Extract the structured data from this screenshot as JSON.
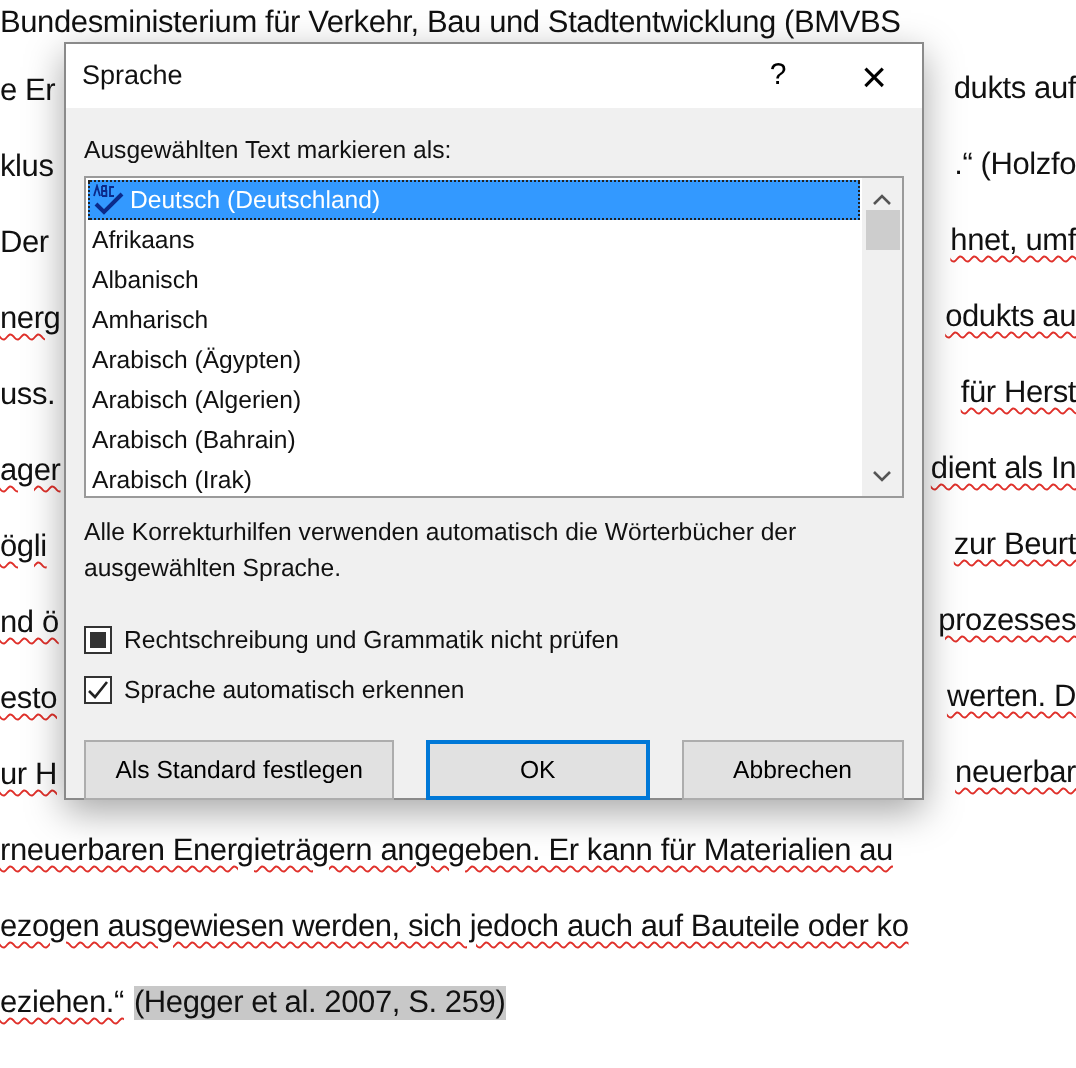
{
  "document": {
    "lines": [
      {
        "left": "Bundesministerium für Verkehr, Bau und Stadtentwicklung (BMVBS",
        "left_flagged": false
      },
      {
        "left": "e Er",
        "right": "dukts auf",
        "left_flagged": false,
        "right_flagged": false
      },
      {
        "left": "klus",
        "right": ".“ (Holzfo",
        "left_flagged": false,
        "right_flagged": false
      },
      {
        "left": "Der",
        "right": "hnet, umf",
        "left_flagged": false,
        "right_flagged": true
      },
      {
        "left": "nerg",
        "right": "odukts au",
        "left_flagged": true,
        "right_flagged": true
      },
      {
        "left": "uss.",
        "right": "für Herst",
        "left_flagged": false,
        "right_flagged": true
      },
      {
        "left": "ager",
        "right": "dient als In",
        "left_flagged": true,
        "right_flagged": true
      },
      {
        "left": "ögli",
        "right": "zur Beurt",
        "left_flagged": true,
        "right_flagged": true
      },
      {
        "left": "nd ö",
        "right": "prozesses",
        "left_flagged": true,
        "right_flagged": true
      },
      {
        "left": "esto",
        "right": "werten. D",
        "left_flagged": true,
        "right_flagged": true
      },
      {
        "left": "ur H",
        "right": "neuerbar",
        "left_flagged": true,
        "right_flagged": true
      },
      {
        "left": "rneuerbaren Energieträgern angegeben. Er kann für Materialien au",
        "left_flagged": true
      },
      {
        "left": "ezogen ausgewiesen werden, sich jedoch auch auf Bauteile oder ko",
        "left_flagged": true
      },
      {
        "left": "eziehen.“",
        "left_flagged": true,
        "citation": "(Hegger et al. 2007, S. 259)"
      }
    ]
  },
  "dialog": {
    "title": "Sprache",
    "help": "?",
    "close": "×",
    "list_label": "Ausgewählten Text markieren als:",
    "languages": [
      {
        "label": "Deutsch (Deutschland)",
        "selected": true
      },
      {
        "label": "Afrikaans",
        "selected": false
      },
      {
        "label": "Albanisch",
        "selected": false
      },
      {
        "label": "Amharisch",
        "selected": false
      },
      {
        "label": "Arabisch (Ägypten)",
        "selected": false
      },
      {
        "label": "Arabisch (Algerien)",
        "selected": false
      },
      {
        "label": "Arabisch (Bahrain)",
        "selected": false
      },
      {
        "label": "Arabisch (Irak)",
        "selected": false
      }
    ],
    "note": "Alle Korrekturhilfen verwenden automatisch die Wörterbücher der ausgewählten Sprache.",
    "options": [
      {
        "label": "Rechtschreibung und Grammatik nicht prüfen",
        "checked": false,
        "indeterminate": true
      },
      {
        "label": "Sprache automatisch erkennen",
        "checked": true,
        "indeterminate": false
      }
    ],
    "buttons": [
      {
        "label": "Als Standard festlegen",
        "default": false
      },
      {
        "label": "OK",
        "default": true
      },
      {
        "label": "Abbrechen",
        "default": false
      }
    ]
  }
}
